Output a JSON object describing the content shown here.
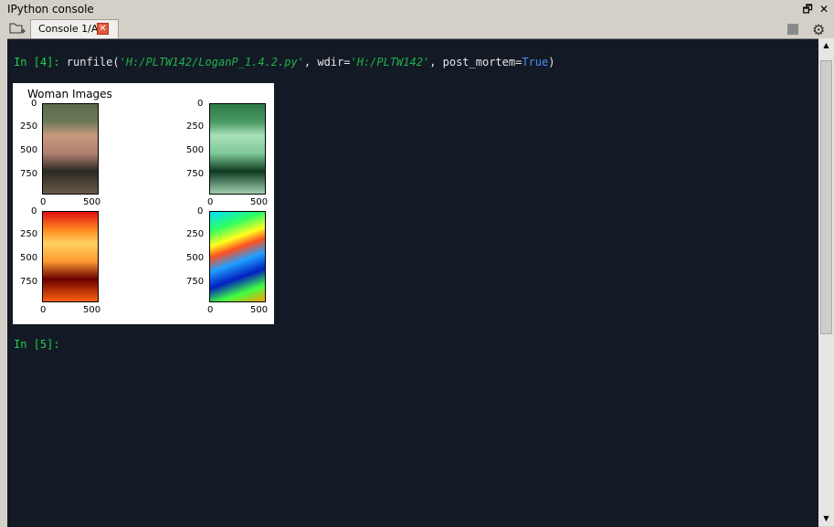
{
  "window": {
    "title": "IPython console",
    "restore_glyph": "🗗",
    "close_glyph": "✕"
  },
  "tabs": [
    {
      "label": "Console 1/A",
      "close_glyph": "✕"
    }
  ],
  "toolbar": {
    "stop_icon": "stop-icon",
    "gear_icon": "gear-icon",
    "gear_glyph": "⚙"
  },
  "console": {
    "line1": {
      "prompt": "In [4]:",
      "func": " runfile(",
      "arg1": "'H:/PLTW142/LoganP_1.4.2.py'",
      "sep": ", wdir=",
      "arg2": "'H:/PLTW142'",
      "sep2": ", post_mortem=",
      "kw": "True",
      "close": ")"
    },
    "line2": {
      "prompt": "In [5]:"
    }
  },
  "figure": {
    "title": "Woman Images",
    "yticks": [
      "0",
      "250",
      "500",
      "750"
    ],
    "xticks": [
      "0",
      "500"
    ]
  },
  "scrollbar": {
    "up": "▲",
    "down": "▼"
  }
}
